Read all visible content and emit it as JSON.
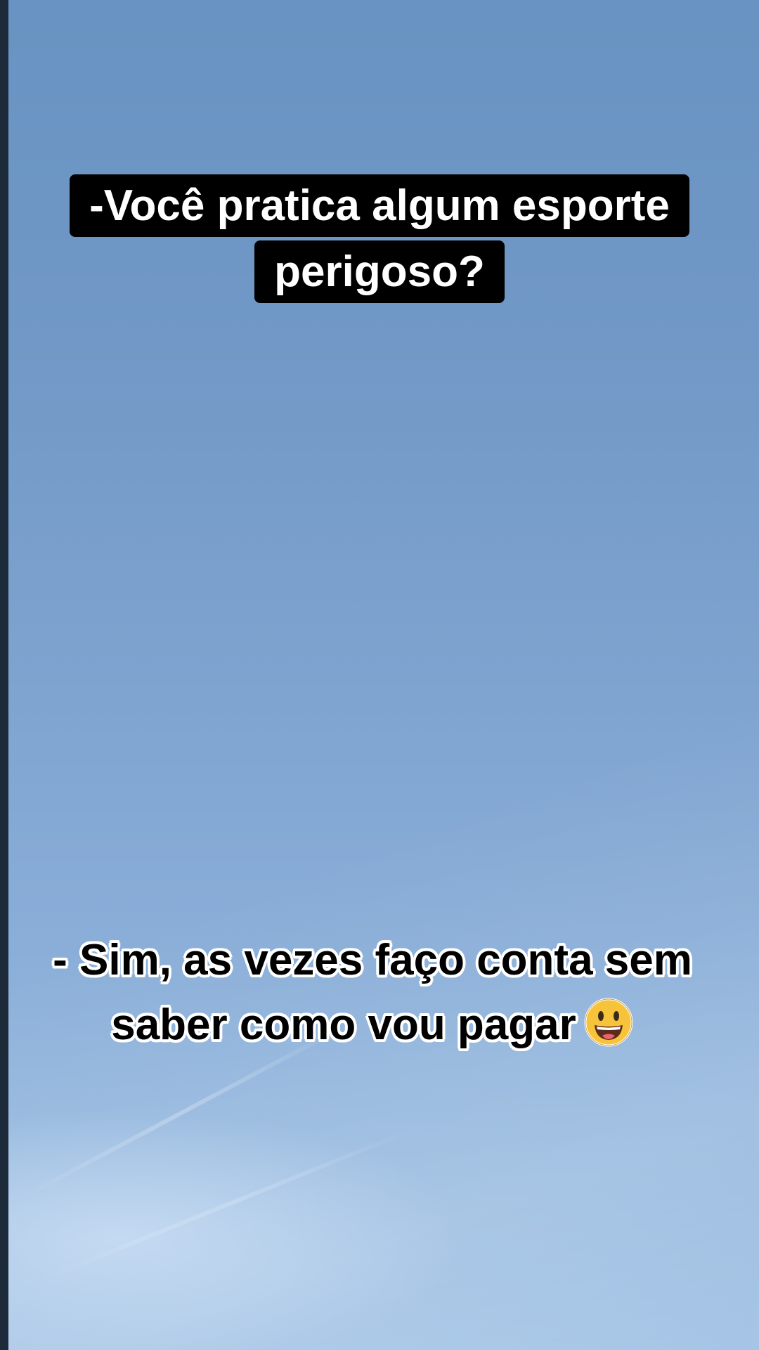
{
  "caption": {
    "question_line1": "-Você pratica algum esporte",
    "question_line2": "perigoso?",
    "answer_line1": "- Sim, as vezes faço conta sem",
    "answer_line2": "saber como vou pagar",
    "answer_emoji": "grinning-face-emoji"
  },
  "colors": {
    "sky_top": "#6893c2",
    "sky_bottom": "#a6c5e6",
    "question_box": "#000000",
    "question_text": "#ffffff",
    "answer_text": "#000000",
    "answer_outline": "#ffffff"
  }
}
